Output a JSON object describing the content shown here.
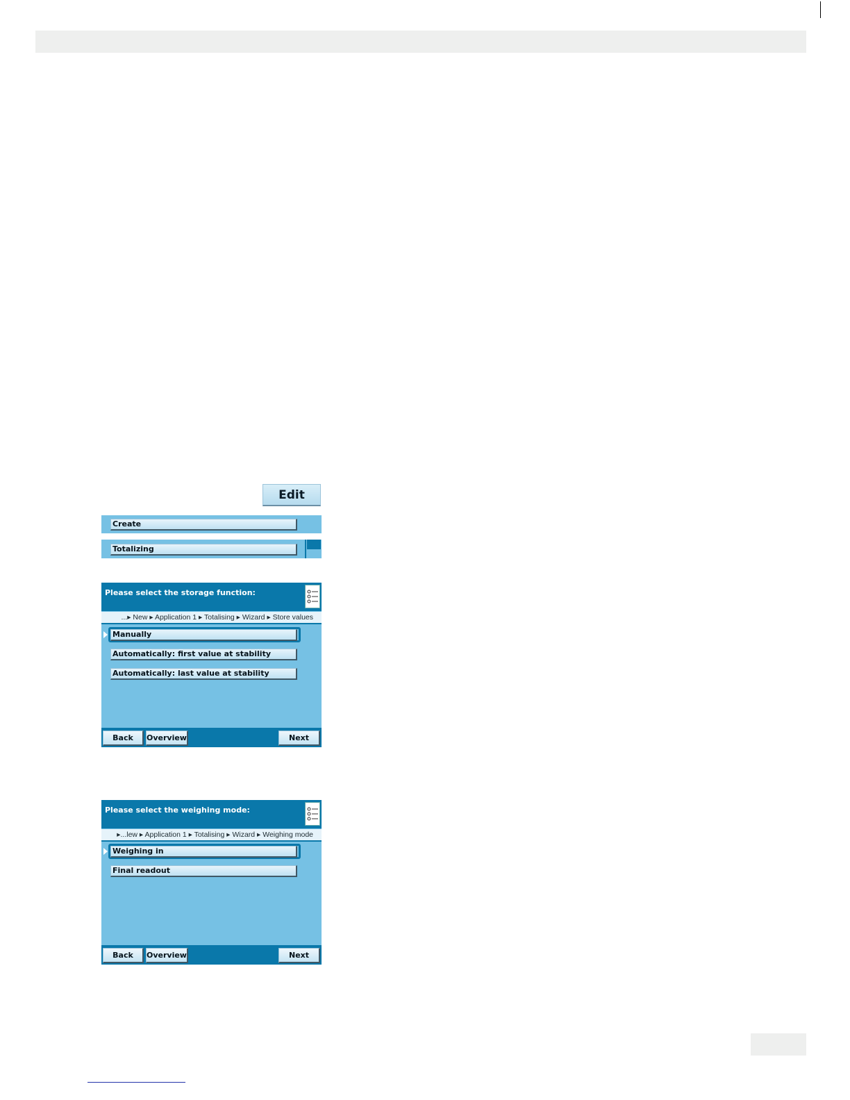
{
  "toolbar": {
    "edit_label": "Edit"
  },
  "strip1": {
    "create_label": "Create"
  },
  "strip2": {
    "totalizing_label": "Totalizing"
  },
  "storage_screen": {
    "title": "Please select the storage function:",
    "breadcrumb": "...▸ New ▸ Application 1 ▸ Totalising ▸ Wizard ▸ Store values",
    "options": [
      "Manually",
      "Automatically: first value at stability",
      "Automatically: last value at stability"
    ],
    "selected_index": 0,
    "buttons": {
      "back": "Back",
      "overview": "Overview",
      "next": "Next"
    }
  },
  "weighing_screen": {
    "title": "Please select the weighing mode:",
    "breadcrumb": "▸...lew ▸ Application 1 ▸ Totalising ▸ Wizard ▸ Weighing mode",
    "options": [
      "Weighing in",
      "Final readout"
    ],
    "selected_index": 0,
    "buttons": {
      "back": "Back",
      "overview": "Overview",
      "next": "Next"
    }
  },
  "colors": {
    "accent": "#0a78aa",
    "panel": "#76c1e4",
    "header_bar": "#eeefee"
  },
  "icons": {
    "list": "list-icon",
    "selection": "selection-arrow-icon"
  }
}
